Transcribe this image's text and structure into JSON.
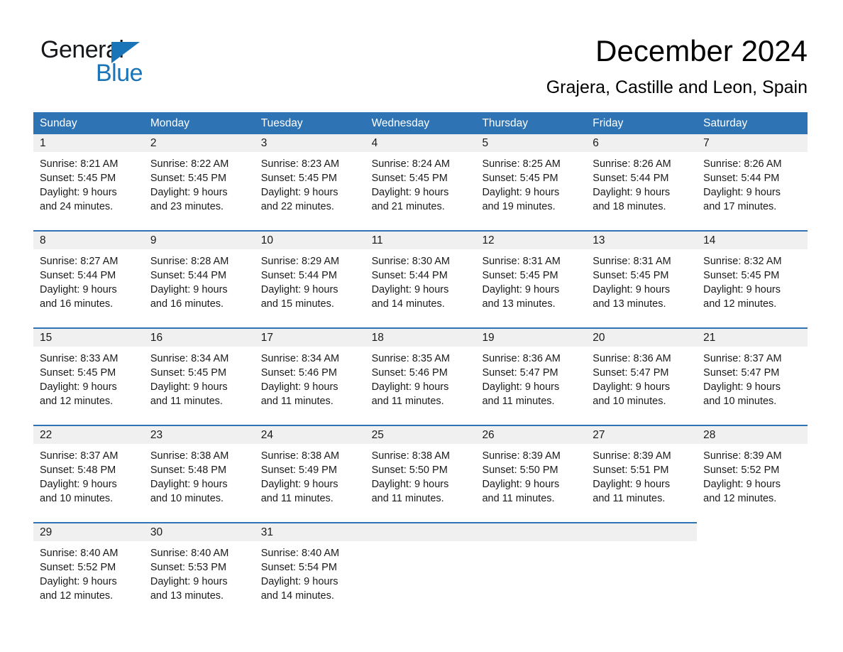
{
  "brand": {
    "name_part1": "General",
    "name_part2": "Blue",
    "accent_color": "#1a74b8"
  },
  "header": {
    "title": "December 2024",
    "subtitle": "Grajera, Castille and Leon, Spain"
  },
  "theme": {
    "header_blue": "#2e74b5",
    "date_bar_gray": "#f0f0f0",
    "text_color": "#1a1a1a"
  },
  "weekdays": [
    "Sunday",
    "Monday",
    "Tuesday",
    "Wednesday",
    "Thursday",
    "Friday",
    "Saturday"
  ],
  "weeks": [
    [
      {
        "date": "1",
        "lines": [
          "Sunrise: 8:21 AM",
          "Sunset: 5:45 PM",
          "Daylight: 9 hours",
          "and 24 minutes."
        ]
      },
      {
        "date": "2",
        "lines": [
          "Sunrise: 8:22 AM",
          "Sunset: 5:45 PM",
          "Daylight: 9 hours",
          "and 23 minutes."
        ]
      },
      {
        "date": "3",
        "lines": [
          "Sunrise: 8:23 AM",
          "Sunset: 5:45 PM",
          "Daylight: 9 hours",
          "and 22 minutes."
        ]
      },
      {
        "date": "4",
        "lines": [
          "Sunrise: 8:24 AM",
          "Sunset: 5:45 PM",
          "Daylight: 9 hours",
          "and 21 minutes."
        ]
      },
      {
        "date": "5",
        "lines": [
          "Sunrise: 8:25 AM",
          "Sunset: 5:45 PM",
          "Daylight: 9 hours",
          "and 19 minutes."
        ]
      },
      {
        "date": "6",
        "lines": [
          "Sunrise: 8:26 AM",
          "Sunset: 5:44 PM",
          "Daylight: 9 hours",
          "and 18 minutes."
        ]
      },
      {
        "date": "7",
        "lines": [
          "Sunrise: 8:26 AM",
          "Sunset: 5:44 PM",
          "Daylight: 9 hours",
          "and 17 minutes."
        ]
      }
    ],
    [
      {
        "date": "8",
        "lines": [
          "Sunrise: 8:27 AM",
          "Sunset: 5:44 PM",
          "Daylight: 9 hours",
          "and 16 minutes."
        ]
      },
      {
        "date": "9",
        "lines": [
          "Sunrise: 8:28 AM",
          "Sunset: 5:44 PM",
          "Daylight: 9 hours",
          "and 16 minutes."
        ]
      },
      {
        "date": "10",
        "lines": [
          "Sunrise: 8:29 AM",
          "Sunset: 5:44 PM",
          "Daylight: 9 hours",
          "and 15 minutes."
        ]
      },
      {
        "date": "11",
        "lines": [
          "Sunrise: 8:30 AM",
          "Sunset: 5:44 PM",
          "Daylight: 9 hours",
          "and 14 minutes."
        ]
      },
      {
        "date": "12",
        "lines": [
          "Sunrise: 8:31 AM",
          "Sunset: 5:45 PM",
          "Daylight: 9 hours",
          "and 13 minutes."
        ]
      },
      {
        "date": "13",
        "lines": [
          "Sunrise: 8:31 AM",
          "Sunset: 5:45 PM",
          "Daylight: 9 hours",
          "and 13 minutes."
        ]
      },
      {
        "date": "14",
        "lines": [
          "Sunrise: 8:32 AM",
          "Sunset: 5:45 PM",
          "Daylight: 9 hours",
          "and 12 minutes."
        ]
      }
    ],
    [
      {
        "date": "15",
        "lines": [
          "Sunrise: 8:33 AM",
          "Sunset: 5:45 PM",
          "Daylight: 9 hours",
          "and 12 minutes."
        ]
      },
      {
        "date": "16",
        "lines": [
          "Sunrise: 8:34 AM",
          "Sunset: 5:45 PM",
          "Daylight: 9 hours",
          "and 11 minutes."
        ]
      },
      {
        "date": "17",
        "lines": [
          "Sunrise: 8:34 AM",
          "Sunset: 5:46 PM",
          "Daylight: 9 hours",
          "and 11 minutes."
        ]
      },
      {
        "date": "18",
        "lines": [
          "Sunrise: 8:35 AM",
          "Sunset: 5:46 PM",
          "Daylight: 9 hours",
          "and 11 minutes."
        ]
      },
      {
        "date": "19",
        "lines": [
          "Sunrise: 8:36 AM",
          "Sunset: 5:47 PM",
          "Daylight: 9 hours",
          "and 11 minutes."
        ]
      },
      {
        "date": "20",
        "lines": [
          "Sunrise: 8:36 AM",
          "Sunset: 5:47 PM",
          "Daylight: 9 hours",
          "and 10 minutes."
        ]
      },
      {
        "date": "21",
        "lines": [
          "Sunrise: 8:37 AM",
          "Sunset: 5:47 PM",
          "Daylight: 9 hours",
          "and 10 minutes."
        ]
      }
    ],
    [
      {
        "date": "22",
        "lines": [
          "Sunrise: 8:37 AM",
          "Sunset: 5:48 PM",
          "Daylight: 9 hours",
          "and 10 minutes."
        ]
      },
      {
        "date": "23",
        "lines": [
          "Sunrise: 8:38 AM",
          "Sunset: 5:48 PM",
          "Daylight: 9 hours",
          "and 10 minutes."
        ]
      },
      {
        "date": "24",
        "lines": [
          "Sunrise: 8:38 AM",
          "Sunset: 5:49 PM",
          "Daylight: 9 hours",
          "and 11 minutes."
        ]
      },
      {
        "date": "25",
        "lines": [
          "Sunrise: 8:38 AM",
          "Sunset: 5:50 PM",
          "Daylight: 9 hours",
          "and 11 minutes."
        ]
      },
      {
        "date": "26",
        "lines": [
          "Sunrise: 8:39 AM",
          "Sunset: 5:50 PM",
          "Daylight: 9 hours",
          "and 11 minutes."
        ]
      },
      {
        "date": "27",
        "lines": [
          "Sunrise: 8:39 AM",
          "Sunset: 5:51 PM",
          "Daylight: 9 hours",
          "and 11 minutes."
        ]
      },
      {
        "date": "28",
        "lines": [
          "Sunrise: 8:39 AM",
          "Sunset: 5:52 PM",
          "Daylight: 9 hours",
          "and 12 minutes."
        ]
      }
    ],
    [
      {
        "date": "29",
        "lines": [
          "Sunrise: 8:40 AM",
          "Sunset: 5:52 PM",
          "Daylight: 9 hours",
          "and 12 minutes."
        ]
      },
      {
        "date": "30",
        "lines": [
          "Sunrise: 8:40 AM",
          "Sunset: 5:53 PM",
          "Daylight: 9 hours",
          "and 13 minutes."
        ]
      },
      {
        "date": "31",
        "lines": [
          "Sunrise: 8:40 AM",
          "Sunset: 5:54 PM",
          "Daylight: 9 hours",
          "and 14 minutes."
        ]
      },
      {
        "date": "",
        "lines": []
      },
      {
        "date": "",
        "lines": []
      },
      {
        "date": "",
        "lines": []
      },
      {
        "date": "",
        "lines": []
      }
    ]
  ]
}
